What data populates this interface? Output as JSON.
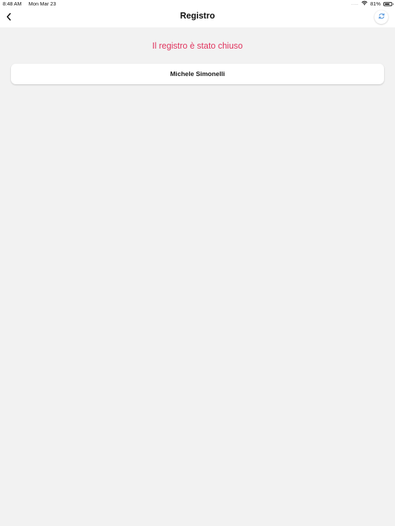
{
  "status_bar": {
    "time": "8:48 AM",
    "date": "Mon Mar 23",
    "signal": ".....",
    "wifi_icon": "wifi-icon",
    "battery_text": "81%",
    "battery_level": 0.81
  },
  "nav": {
    "back_icon": "chevron-left-icon",
    "title": "Registro",
    "refresh_icon": "refresh-icon",
    "refresh_color": "#4a90d9"
  },
  "main": {
    "closed_message": "Il registro è stato chiuso",
    "closed_message_color": "#e0355f",
    "people": [
      {
        "name": "Michele Simonelli"
      }
    ]
  }
}
